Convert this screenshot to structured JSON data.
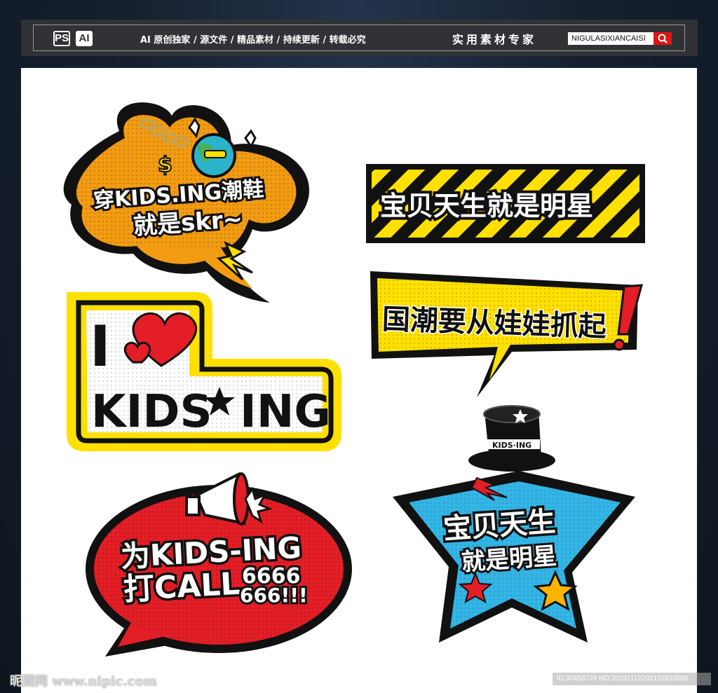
{
  "topbar": {
    "badges": [
      "PS",
      "AI"
    ],
    "tagline": "AI 原创独家 / 源文件 / 精品素材 / 持续更新 / 转载必究",
    "expert": "实用素材专家",
    "search_value": "NIGULASIXIANCAISI",
    "search_icon": "search-icon"
  },
  "stickers": {
    "shoes": {
      "line1": "穿KIDS.ING潮鞋",
      "line2": "就是skr~",
      "color": "#f39c12"
    },
    "baby_star_banner": {
      "text": "宝贝天生就是明星",
      "color": "#ffe000"
    },
    "i_love": {
      "i": "I",
      "brand": "KIDS",
      "brand2": "ING",
      "color": "#ffe000"
    },
    "guochao": {
      "text": "国潮要从娃娃抓起",
      "color": "#ffe000"
    },
    "call": {
      "line1": "为KIDS-ING",
      "line2": "打CALL",
      "num1": "6666",
      "num2": "666!!!",
      "color": "#e41e26"
    },
    "star": {
      "line1": "宝贝天生",
      "line2": "就是明星",
      "hat": "KIDS·ING",
      "color": "#33b5e5"
    }
  },
  "watermarks": {
    "left": "昵图网 www.nipic.com",
    "right": "ID:30453729 NO:20191112202102910088"
  }
}
